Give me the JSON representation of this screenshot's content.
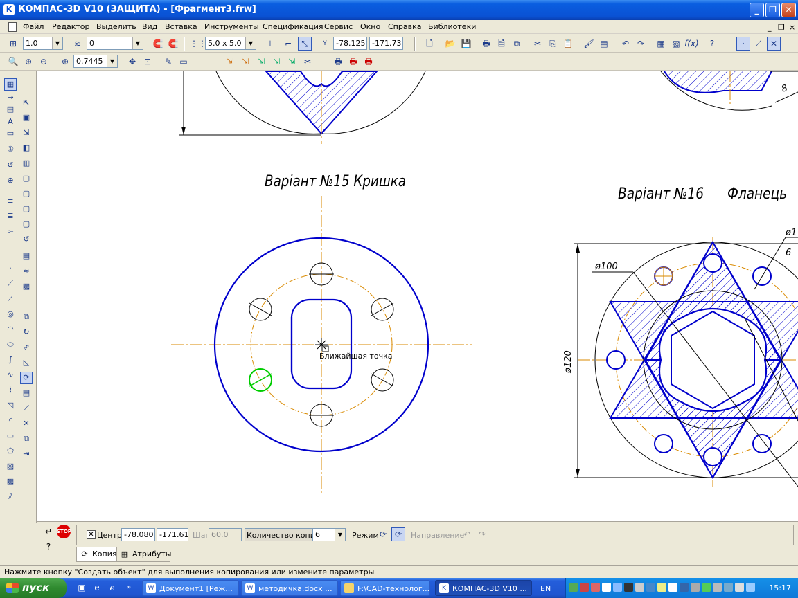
{
  "window": {
    "title": "КОМПАС-3D V10 (ЗАЩИТА) - [Фрагмент3.frw]",
    "icon": "kompas-icon"
  },
  "menu": {
    "items": [
      "Файл",
      "Редактор",
      "Выделить",
      "Вид",
      "Вставка",
      "Инструменты",
      "Спецификация",
      "Сервис",
      "Окно",
      "Справка",
      "Библиотеки"
    ]
  },
  "toolbar1": {
    "scale": "1.0",
    "layer": "0",
    "grid": "5.0 x 5.0",
    "x": "-78.125",
    "y": "-171.73"
  },
  "toolbar2": {
    "zoom": "0.7445"
  },
  "drawing": {
    "title15": "Варiант №15 Кришка",
    "title16": "Варiант №16",
    "title16b": "Фланець",
    "cursor_hint": "Ближайшая точка",
    "dim_d100": "ø100",
    "dim_d120": "ø120",
    "dim_8": "8",
    "dim_d1": "ø1",
    "dim_6": "6",
    "colors": {
      "contour": "#0000cc",
      "axis": "#d98a00",
      "hatch": "#0000cc",
      "selected": "#00cc00"
    }
  },
  "properties": {
    "center_label": "Центр",
    "center_x": "-78.080",
    "center_y": "-171.61",
    "step_label": "Шаг",
    "step_value": "60.0",
    "copies_label": "Количество копий",
    "copies_value": "6",
    "mode_label": "Режим",
    "direction_label": "Направление",
    "tabs": [
      "Копия",
      "Атрибуты"
    ]
  },
  "status": {
    "message": "Нажмите кнопку \"Создать объект\" для выполнения копирования или измените параметры"
  },
  "taskbar": {
    "start": "пуск",
    "tasks": [
      "Документ1 [Реж...",
      "методичка.docx ...",
      "F:\\CAD-технолог...",
      "КОМПАС-3D V10 ..."
    ],
    "lang": "EN",
    "clock": "15:17"
  }
}
